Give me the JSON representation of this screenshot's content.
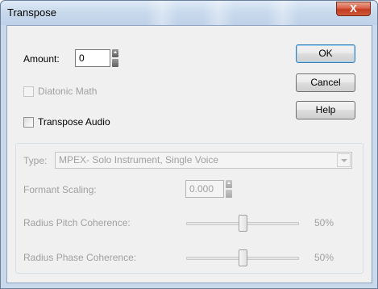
{
  "window": {
    "title": "Transpose",
    "close_glyph": "X"
  },
  "amount": {
    "label": "Amount:",
    "value": "0"
  },
  "buttons": {
    "ok": "OK",
    "cancel": "Cancel",
    "help": "Help"
  },
  "diatonic": {
    "label": "Diatonic Math",
    "checked": false,
    "enabled": false
  },
  "transpose_audio": {
    "label": "Transpose Audio",
    "checked": false,
    "enabled": true
  },
  "audio_group": {
    "type_label": "Type:",
    "type_value": "MPEX- Solo Instrument, Single Voice",
    "formant_label": "Formant Scaling:",
    "formant_value": "0.000",
    "pitch_label": "Radius Pitch Coherence:",
    "pitch_value": "50%",
    "pitch_level": 0.5,
    "phase_label": "Radius Phase Coherence:",
    "phase_value": "50%",
    "phase_level": 0.5
  },
  "icons": [
    "close-icon",
    "spinner-up-icon",
    "spinner-down-icon",
    "dropdown-arrow-icon"
  ]
}
